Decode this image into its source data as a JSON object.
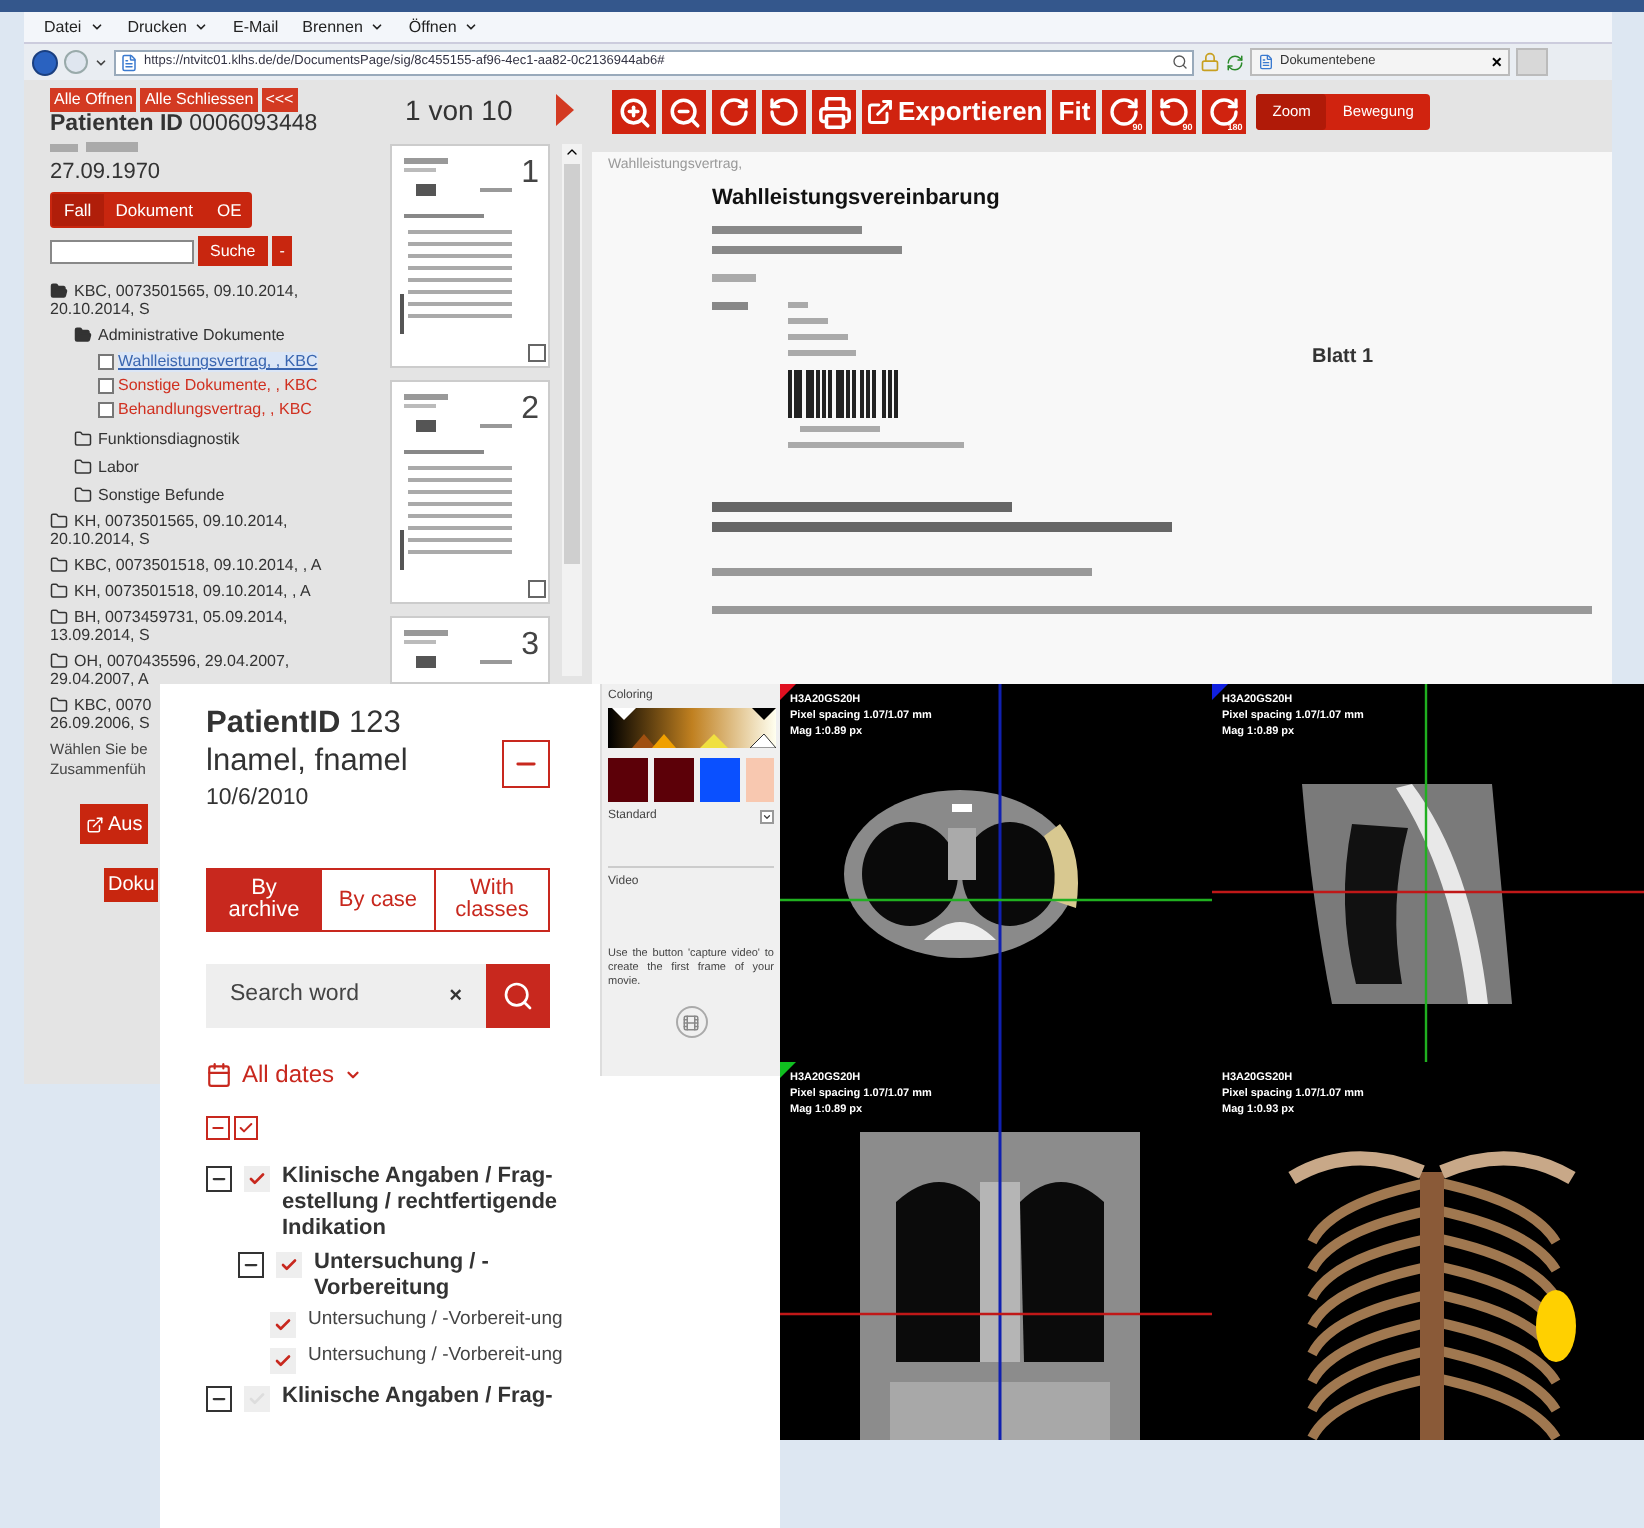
{
  "browser": {
    "menu": [
      {
        "label": "Datei",
        "dropdown": true
      },
      {
        "label": "Drucken",
        "dropdown": true
      },
      {
        "label": "E-Mail",
        "dropdown": false
      },
      {
        "label": "Brennen",
        "dropdown": true
      },
      {
        "label": "Öffnen",
        "dropdown": true
      }
    ],
    "address": "https://ntvitc01.klhs.de/de/DocumentsPage/sig/8c455155-af96-4ec1-aa82-0c2136944ab6#",
    "tab": {
      "title": "Dokumentebene",
      "close": "×"
    }
  },
  "archive": {
    "top_buttons": [
      "Alle Offnen",
      "Alle Schliessen",
      "<<<"
    ],
    "patient_label": "Patienten ID",
    "patient_id": "0006093448",
    "birth_date": "27.09.1970",
    "view_tabs": [
      {
        "label": "Fall",
        "selected": true
      },
      {
        "label": "Dokument",
        "selected": false
      },
      {
        "label": "OE",
        "selected": false
      }
    ],
    "search_button": "Suche",
    "minus_button": "-",
    "tree": [
      {
        "kind": "folder",
        "expanded": true,
        "lines": [
          "KBC, 0073501565, 09.10.2014,",
          "20.10.2014, S"
        ],
        "children": [
          {
            "kind": "folder",
            "expanded": true,
            "lines": [
              "Administrative Dokumente"
            ],
            "children": [
              {
                "kind": "document",
                "selected": true,
                "checked": false,
                "lines": [
                  "Wahlleistungsvertrag, , KBC"
                ]
              },
              {
                "kind": "document",
                "selected": false,
                "checked": false,
                "lines": [
                  "Sonstige Dokumente, , KBC"
                ]
              },
              {
                "kind": "document",
                "selected": false,
                "checked": false,
                "lines": [
                  "Behandlungsvertrag, , KBC"
                ]
              }
            ]
          },
          {
            "kind": "folder",
            "expanded": false,
            "lines": [
              "Funktionsdiagnostik"
            ]
          },
          {
            "kind": "folder",
            "expanded": false,
            "lines": [
              "Labor"
            ]
          },
          {
            "kind": "folder",
            "expanded": false,
            "lines": [
              "Sonstige Befunde"
            ]
          }
        ]
      },
      {
        "kind": "folder",
        "expanded": false,
        "lines": [
          "KH, 0073501565, 09.10.2014,",
          "20.10.2014, S"
        ]
      },
      {
        "kind": "folder",
        "expanded": false,
        "lines": [
          "KBC, 0073501518, 09.10.2014, , A"
        ]
      },
      {
        "kind": "folder",
        "expanded": false,
        "lines": [
          "KH, 0073501518, 09.10.2014, , A"
        ]
      },
      {
        "kind": "folder",
        "expanded": false,
        "lines": [
          "BH, 0073459731, 05.09.2014,",
          "13.09.2014, S"
        ]
      },
      {
        "kind": "folder",
        "expanded": false,
        "lines": [
          "OH, 0070435596, 29.04.2007,",
          "29.04.2007, A"
        ]
      },
      {
        "kind": "folder",
        "expanded": false,
        "lines": [
          "KBC, 0070",
          "26.09.2006, S"
        ]
      }
    ],
    "hint": [
      "Wählen Sie be",
      "Zusammenfüh"
    ],
    "export_button": "Aus",
    "doc_button": "Doku"
  },
  "pager": {
    "text": "1 von 10"
  },
  "thumbnails": [
    {
      "page": "1",
      "checked": false
    },
    {
      "page": "2",
      "checked": false
    },
    {
      "page": "3"
    }
  ],
  "toolbar": [
    {
      "kind": "zoom-in"
    },
    {
      "kind": "zoom-out"
    },
    {
      "kind": "rotate-right"
    },
    {
      "kind": "rotate-left"
    },
    {
      "kind": "print"
    },
    {
      "kind": "export",
      "label": "Exportieren"
    },
    {
      "kind": "text",
      "label": "Fit"
    },
    {
      "kind": "rotate-right",
      "badge": "90"
    },
    {
      "kind": "rotate-left",
      "badge": "90"
    },
    {
      "kind": "rotate-right",
      "badge": "180"
    }
  ],
  "mode_tabs": [
    {
      "label": "Zoom",
      "selected": true
    },
    {
      "label": "Bewegung",
      "selected": false
    }
  ],
  "document": {
    "caption": "Wahlleistungsvertrag,",
    "title": "Wahlleistungsvereinbarung",
    "sheet": "Blatt 1"
  },
  "viewer": {
    "patient_label": "PatientID",
    "patient_id": "123",
    "name": "lnamel, fnamel",
    "date": "10/6/2010",
    "tabs": [
      {
        "label": "By archive",
        "selected": true
      },
      {
        "label": "By case",
        "selected": false
      },
      {
        "label": "With classes",
        "selected": false
      }
    ],
    "search": {
      "placeholder": "Search word",
      "clear": "×"
    },
    "date_filter": "All dates",
    "tree": [
      {
        "label": "Klinische Angaben / Frag-estellung / rechtfertigende Indikation",
        "checked": true,
        "expanded": true,
        "children": [
          {
            "label": "Untersuchung / -Vorbereitung",
            "checked": true,
            "expanded": true,
            "children": [
              {
                "label": "Untersuchung / -Vorbereit-ung",
                "checked": true
              },
              {
                "label": "Untersuchung / -Vorbereit-ung",
                "checked": true
              }
            ]
          }
        ]
      },
      {
        "label": "Klinische Angaben / Frag-",
        "checked": false,
        "expanded": true
      }
    ]
  },
  "coloring": {
    "title": "Coloring",
    "swatches": [
      {
        "color": "#5c0008"
      },
      {
        "color": "#5c0008"
      },
      {
        "color": "#0a50ff"
      },
      {
        "color": "#f8c8b0"
      }
    ],
    "preset": "Standard"
  },
  "video": {
    "title": "Video",
    "hint": "Use the button 'capture video' to create the first frame of your movie."
  },
  "views": [
    {
      "kind": "axial",
      "color": "#e01020",
      "series": "H3A20GS20H",
      "spacing": "Pixel spacing 1.07/1.07 mm",
      "mag": "Mag 1:0.89 px"
    },
    {
      "kind": "sagittal",
      "color": "#1020e0",
      "series": "H3A20GS20H",
      "spacing": "Pixel spacing 1.07/1.07 mm",
      "mag": "Mag 1:0.89 px"
    },
    {
      "kind": "coronal",
      "color": "#10c020",
      "series": "H3A20GS20H",
      "spacing": "Pixel spacing 1.07/1.07 mm",
      "mag": "Mag 1:0.89 px"
    },
    {
      "kind": "volume",
      "series": "H3A20GS20H",
      "spacing": "Pixel spacing 1.07/1.07 mm",
      "mag": "Mag 1:0.93 px"
    }
  ]
}
